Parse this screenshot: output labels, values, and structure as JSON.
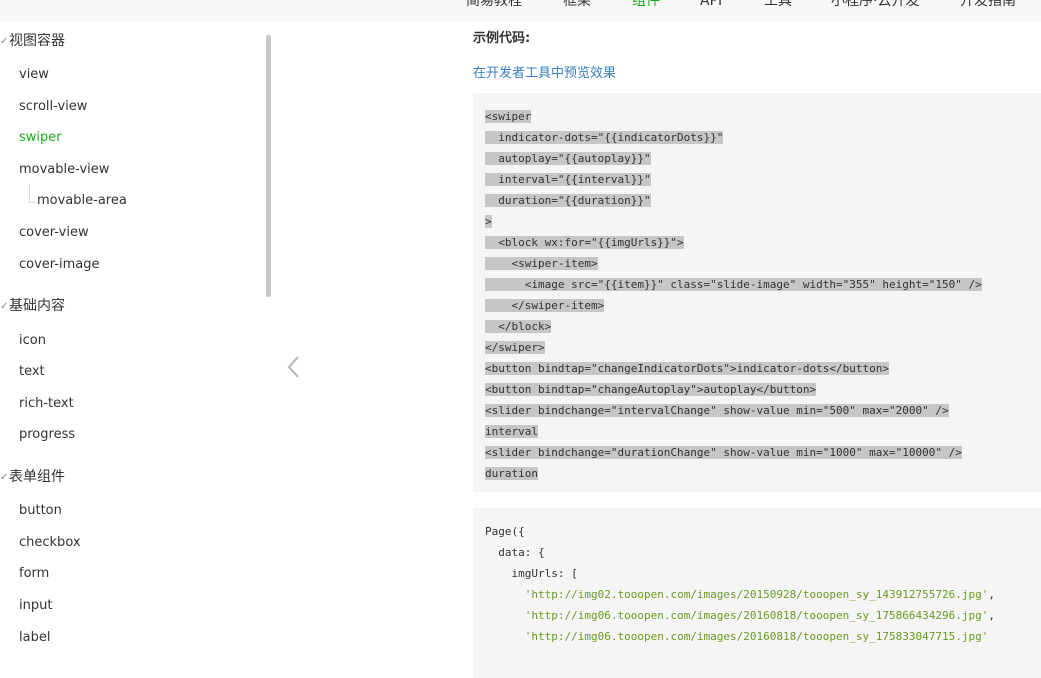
{
  "topnav": {
    "items": [
      {
        "label": "简易教程"
      },
      {
        "label": "框架"
      },
      {
        "label": "组件",
        "active": true
      },
      {
        "label": "API"
      },
      {
        "label": "工具"
      },
      {
        "label": "小程序·云开发"
      },
      {
        "label": "开发指南"
      }
    ]
  },
  "sidebar": {
    "groups": [
      {
        "label": "视图容器",
        "items": [
          "view",
          "scroll-view",
          "swiper",
          "movable-view",
          "movable-area",
          "cover-view",
          "cover-image"
        ]
      },
      {
        "label": "基础内容",
        "items": [
          "icon",
          "text",
          "rich-text",
          "progress"
        ]
      },
      {
        "label": "表单组件",
        "items": [
          "button",
          "checkbox",
          "form",
          "input",
          "label"
        ]
      }
    ],
    "active_item": "swiper",
    "collapse_icon": "chevron-left-icon"
  },
  "main": {
    "heading": "示例代码:",
    "preview_link": "在开发者工具中预览效果",
    "code_wxml": [
      "<swiper",
      "  indicator-dots=\"{{indicatorDots}}\"",
      "  autoplay=\"{{autoplay}}\"",
      "  interval=\"{{interval}}\"",
      "  duration=\"{{duration}}\"",
      ">",
      "  <block wx:for=\"{{imgUrls}}\">",
      "    <swiper-item>",
      "      <image src=\"{{item}}\" class=\"slide-image\" width=\"355\" height=\"150\" />",
      "    </swiper-item>",
      "  </block>",
      "</swiper>",
      "<button bindtap=\"changeIndicatorDots\">indicator-dots</button>",
      "<button bindtap=\"changeAutoplay\">autoplay</button>",
      "<slider bindchange=\"intervalChange\" show-value min=\"500\" max=\"2000\" />",
      "interval",
      "<slider bindchange=\"durationChange\" show-value min=\"1000\" max=\"10000\" />",
      "duration"
    ],
    "code_js": [
      "Page({",
      "  data: {",
      "    imgUrls: [",
      "      'http://img02.tooopen.com/images/20150928/tooopen_sy_143912755726.jpg',",
      "      'http://img06.tooopen.com/images/20160818/tooopen_sy_175866434296.jpg',",
      "      'http://img06.tooopen.com/images/20160818/tooopen_sy_175833047715.jpg'"
    ]
  },
  "colors": {
    "accent": "#1aad19",
    "link": "#3a7fc0",
    "code_bg": "#f5f5f5",
    "selection": "#c6c6c6",
    "string": "#6a9a23"
  }
}
